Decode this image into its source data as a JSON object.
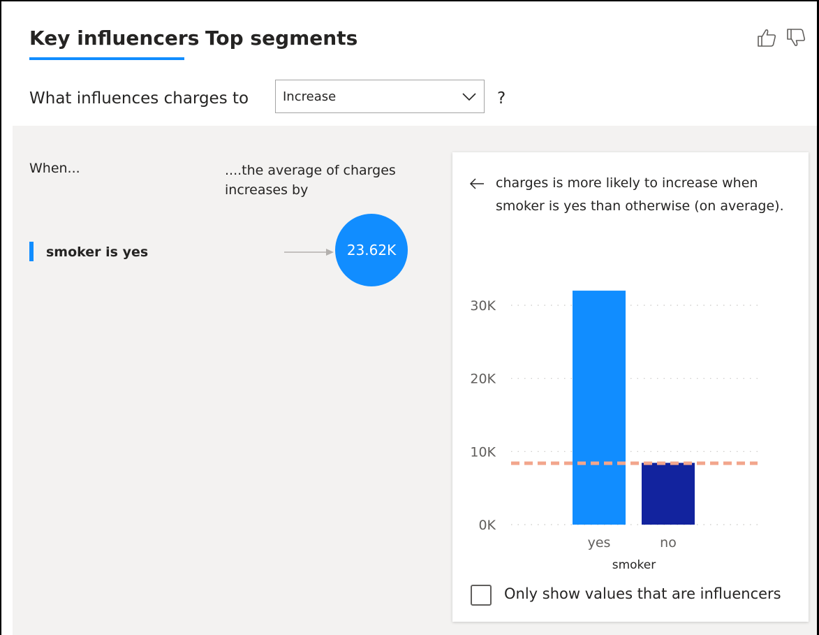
{
  "tabs": [
    {
      "label": "Key influencers",
      "active": true
    },
    {
      "label": "Top segments",
      "active": false
    }
  ],
  "feedback": {
    "like_icon": "thumbs-up-icon",
    "dislike_icon": "thumbs-down-icon"
  },
  "question": {
    "prefix": "What influences charges to",
    "selected": "Increase",
    "suffix": "?"
  },
  "columns": {
    "when": "When...",
    "effect": "....the average of charges increases by"
  },
  "influencers": [
    {
      "label": "smoker is yes",
      "value": "23.62K"
    }
  ],
  "detail": {
    "description": "charges is more likely to increase when smoker is yes than otherwise (on average).",
    "checkbox_label": "Only show values that are influencers"
  },
  "colors": {
    "accent": "#118dff",
    "secondary_bar": "#12239e",
    "average_line": "#f2a68c",
    "panel_bg": "#f3f2f1"
  },
  "chart_data": {
    "type": "bar",
    "categories": [
      "yes",
      "no"
    ],
    "values": [
      32000,
      8450
    ],
    "average_line": 8400,
    "xlabel": "smoker",
    "ylabel": "",
    "ylim": [
      0,
      30000
    ],
    "yticks": [
      "0K",
      "10K",
      "20K",
      "30K"
    ],
    "ytick_values": [
      0,
      10000,
      20000,
      30000
    ],
    "grid": true
  }
}
